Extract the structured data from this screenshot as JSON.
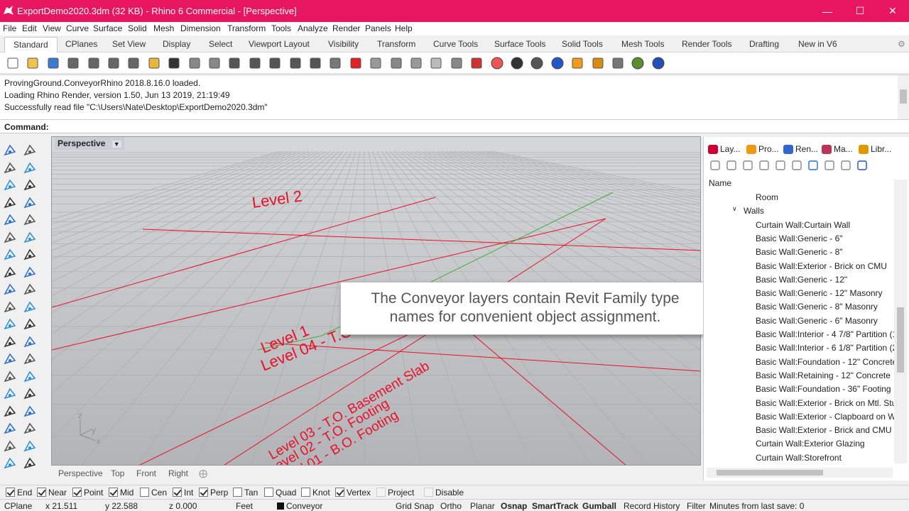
{
  "window": {
    "title": "ExportDemo2020.3dm (32 KB) - Rhino 6 Commercial - [Perspective]",
    "accent": "#e8165e"
  },
  "menu": [
    "File",
    "Edit",
    "View",
    "Curve",
    "Surface",
    "Solid",
    "Mesh",
    "Dimension",
    "Transform",
    "Tools",
    "Analyze",
    "Render",
    "Panels",
    "Help"
  ],
  "tabs": [
    "Standard",
    "CPlanes",
    "Set View",
    "Display",
    "Select",
    "Viewport Layout",
    "Visibility",
    "Transform",
    "Curve Tools",
    "Surface Tools",
    "Solid Tools",
    "Mesh Tools",
    "Render Tools",
    "Drafting",
    "New in V6"
  ],
  "history": [
    "ProvingGround.ConveyorRhino 2018.8.16.0 loaded.",
    "Loading Rhino Render, version 1.50, Jun 13 2019, 21:19:49",
    "Successfully read file \"C:\\Users\\Nate\\Desktop\\ExportDemo2020.3dm\""
  ],
  "command": {
    "label": "Command:"
  },
  "viewport": {
    "title": "Perspective",
    "labels": [
      "Level 2",
      "Level 1",
      "Level 04 - T.O.",
      "Level 03 - T.O. Basement Slab",
      "Level 02 - T.O. Footing",
      "Level 01 - B.O. Footing"
    ],
    "axes": {
      "z": "z",
      "y": "y",
      "x": "x"
    },
    "tabs": [
      "Perspective",
      "Top",
      "Front",
      "Right"
    ]
  },
  "callout": {
    "line1": "The Conveyor layers contain Revit Family type",
    "line2": "names for convenient object assignment."
  },
  "panel": {
    "tabs": [
      "Lay...",
      "Pro...",
      "Ren...",
      "Ma...",
      "Libr..."
    ],
    "header": "Name",
    "layers": [
      "Room",
      "Walls",
      "Curtain Wall:Curtain Wall",
      "Basic Wall:Generic - 6\"",
      "Basic Wall:Generic - 8\"",
      "Basic Wall:Exterior - Brick on CMU",
      "Basic Wall:Generic - 12\"",
      "Basic Wall:Generic - 12\" Masonry",
      "Basic Wall:Generic - 8\" Masonry",
      "Basic Wall:Generic - 6\" Masonry",
      "Basic Wall:Interior - 4 7/8\" Partition (1",
      "Basic Wall:Interior - 6 1/8\" Partition (2",
      "Basic Wall:Foundation - 12\" Concrete",
      "Basic Wall:Retaining - 12\" Concrete",
      "Basic Wall:Foundation - 36\" Footing",
      "Basic Wall:Exterior - Brick on Mtl. Stud",
      "Basic Wall:Exterior - Clapboard on Wo",
      "Basic Wall:Exterior - Brick and CMU on",
      "Curtain Wall:Exterior Glazing",
      "Curtain Wall:Storefront"
    ]
  },
  "osnaps": [
    {
      "label": "End",
      "checked": true
    },
    {
      "label": "Near",
      "checked": true
    },
    {
      "label": "Point",
      "checked": true
    },
    {
      "label": "Mid",
      "checked": true
    },
    {
      "label": "Cen",
      "checked": false
    },
    {
      "label": "Int",
      "checked": true
    },
    {
      "label": "Perp",
      "checked": true
    },
    {
      "label": "Tan",
      "checked": false
    },
    {
      "label": "Quad",
      "checked": false
    },
    {
      "label": "Knot",
      "checked": false
    },
    {
      "label": "Vertex",
      "checked": true
    },
    {
      "label": "Project",
      "checked": false
    },
    {
      "label": "Disable",
      "checked": false
    }
  ],
  "status": {
    "cplane": "CPlane",
    "x": "x 21.511",
    "y": "y 22.588",
    "z": "z 0.000",
    "units": "Feet",
    "layer": "Conveyor",
    "grid_snap": "Grid Snap",
    "ortho": "Ortho",
    "planar": "Planar",
    "osnap": "Osnap",
    "smarttrack": "SmartTrack",
    "gumball": "Gumball",
    "record_history": "Record History",
    "filter": "Filter",
    "minutes": "Minutes from last save: 0"
  }
}
